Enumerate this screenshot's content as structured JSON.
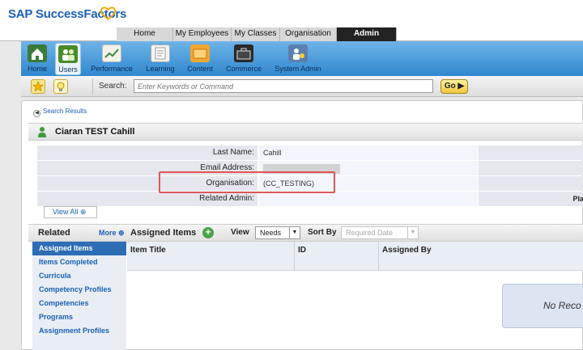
{
  "brand": {
    "name": "SAP SuccessFactors"
  },
  "top_nav": {
    "tabs": [
      {
        "label": "Home",
        "active": false
      },
      {
        "label": "My Employees",
        "active": false
      },
      {
        "label": "My Classes",
        "active": false
      },
      {
        "label": "Organisation",
        "active": false
      },
      {
        "label": "Admin",
        "active": true
      }
    ]
  },
  "modules": {
    "items": [
      {
        "label": "Home",
        "icon": "home-icon"
      },
      {
        "label": "Users",
        "icon": "users-icon",
        "active": true
      },
      {
        "label": "Performance",
        "icon": "performance-icon"
      },
      {
        "label": "Learning",
        "icon": "learning-icon"
      },
      {
        "label": "Content",
        "icon": "content-icon"
      },
      {
        "label": "Commerce",
        "icon": "commerce-icon"
      },
      {
        "label": "System Admin",
        "icon": "system-admin-icon"
      }
    ]
  },
  "search": {
    "label": "Search:",
    "placeholder": "Enter Keywords or Command",
    "go_label": "Go"
  },
  "breadcrumb": {
    "label": "Search Results"
  },
  "person": {
    "name": "Ciaran TEST Cahill"
  },
  "info": {
    "rows": [
      {
        "label": "Last Name:",
        "value": "Cahill"
      },
      {
        "label": "Email Address:",
        "value": ""
      },
      {
        "label": "Organisation:",
        "value": "(CC_TESTING)"
      },
      {
        "label": "Related Admin:",
        "value": "",
        "right_label": "Pla"
      }
    ],
    "view_all": "View All"
  },
  "related": {
    "title": "Related",
    "more": "More",
    "items": [
      {
        "label": "Assigned Items",
        "active": true
      },
      {
        "label": "Items Completed"
      },
      {
        "label": "Curricula"
      },
      {
        "label": "Competency Profiles"
      },
      {
        "label": "Competencies"
      },
      {
        "label": "Programs"
      },
      {
        "label": "Assignment Profiles"
      }
    ]
  },
  "assigned": {
    "title": "Assigned Items",
    "view_label": "View",
    "view_value": "Needs",
    "sort_label": "Sort By",
    "sort_value": "Required Date",
    "columns": [
      "Item Title",
      "ID",
      "Assigned By"
    ],
    "empty_text": "No Reco"
  },
  "colors": {
    "brand_blue": "#1a5fb4",
    "toolbar_blue": "#2f87cf",
    "active_blue": "#2d6db5",
    "highlight_red": "#e05555",
    "brand_heart": "#f0a800"
  }
}
